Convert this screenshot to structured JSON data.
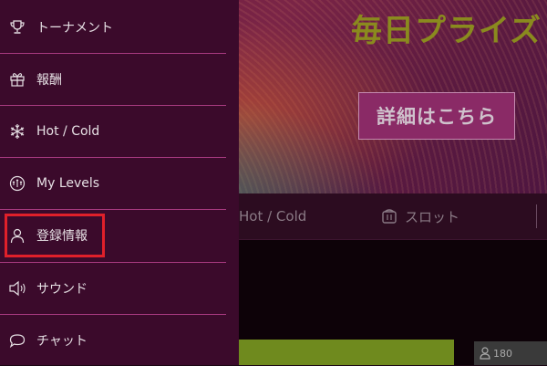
{
  "banner": {
    "title": "毎日プライズ",
    "details_button": "詳細はこちら"
  },
  "tabs": [
    {
      "label": "Hot / Cold"
    },
    {
      "label": "スロット",
      "icon": "slot-machine-icon"
    }
  ],
  "player_badge": {
    "count": "180",
    "icon": "person-icon"
  },
  "menu": {
    "items": [
      {
        "label": "トーナメント",
        "icon": "trophy-icon"
      },
      {
        "label": "報酬",
        "icon": "gift-icon"
      },
      {
        "label": "Hot / Cold",
        "icon": "snowflake-icon"
      },
      {
        "label": "My Levels",
        "icon": "levels-gauge-icon"
      },
      {
        "label": "登録情報",
        "icon": "user-icon",
        "highlighted": true
      },
      {
        "label": "サウンド",
        "icon": "speaker-icon"
      },
      {
        "label": "チャット",
        "icon": "chat-bubble-icon"
      }
    ]
  },
  "colors": {
    "menu_background": "#3b0a2b",
    "divider": "#a83a80",
    "highlight": "#e0202a",
    "banner_title": "#8a8a1e",
    "details_button": "#8a2a66"
  }
}
